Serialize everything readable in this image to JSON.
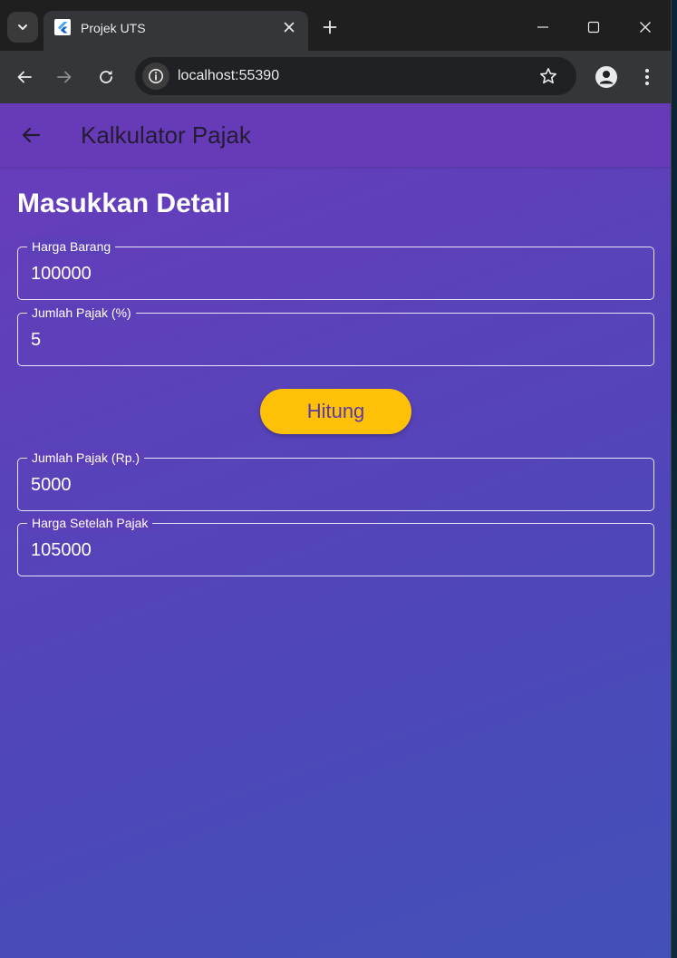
{
  "browser": {
    "tab_title": "Projek UTS",
    "url": "localhost:55390"
  },
  "app": {
    "appbar_title": "Kalkulator Pajak",
    "section_title": "Masukkan Detail",
    "fields": {
      "harga_barang": {
        "label": "Harga Barang",
        "value": "100000"
      },
      "jumlah_pajak_persen": {
        "label": "Jumlah Pajak (%)",
        "value": "5"
      },
      "jumlah_pajak_rp": {
        "label": "Jumlah Pajak (Rp.)",
        "value": "5000"
      },
      "harga_setelah_pajak": {
        "label": "Harga Setelah Pajak",
        "value": "105000"
      }
    },
    "button_label": "Hitung"
  },
  "colors": {
    "appbar": "#673ab7",
    "button": "#ffc107",
    "button_text": "#5b3aa5"
  },
  "icons": {
    "tab_search": "chevron-down-icon",
    "favicon": "flutter-logo-icon",
    "tab_close": "close-icon",
    "new_tab": "plus-icon",
    "minimize": "minimize-icon",
    "maximize": "maximize-icon",
    "window_close": "close-icon",
    "back": "arrow-left-icon",
    "forward": "arrow-right-icon",
    "reload": "reload-icon",
    "site_info": "info-icon",
    "bookmark": "star-icon",
    "profile": "person-icon",
    "menu": "kebab-menu-icon",
    "app_back": "arrow-left-icon"
  }
}
